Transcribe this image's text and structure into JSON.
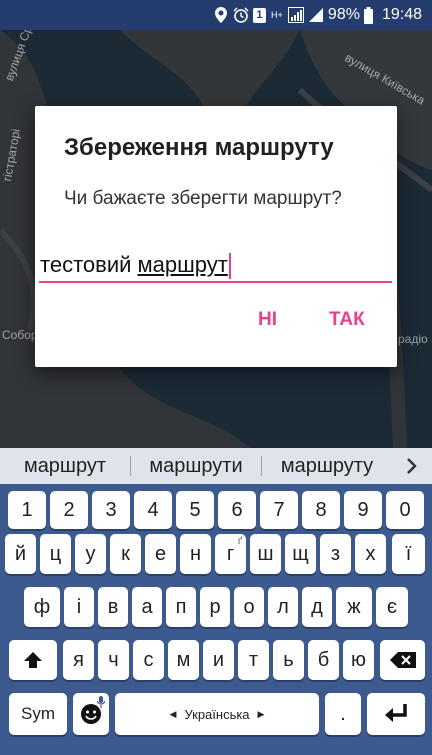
{
  "status_bar": {
    "battery_percent": "98%",
    "time": "19:48",
    "sim_badge": "1",
    "network": "H+",
    "icons": [
      "location-icon",
      "alarm-icon",
      "sim-icon",
      "signal-icon",
      "signal-icon",
      "battery-icon"
    ]
  },
  "map": {
    "labels": [
      "вулиця Срус",
      "вулиця Київська",
      "гістраторі",
      "Собор",
      "радіо"
    ]
  },
  "dialog": {
    "title": "Збереження маршруту",
    "message": "Чи бажаєте зберегти маршрут?",
    "input_plain": "тестовий ",
    "input_underlined": "маршрут",
    "negative_label": "НІ",
    "positive_label": "ТАК"
  },
  "suggestions": {
    "items": [
      "маршрут",
      "маршрути",
      "маршруту"
    ],
    "more_icon": "chevron-right-icon"
  },
  "keyboard": {
    "row1": [
      "1",
      "2",
      "3",
      "4",
      "5",
      "6",
      "7",
      "8",
      "9",
      "0"
    ],
    "row2": [
      "й",
      "ц",
      "у",
      "к",
      "е",
      "н",
      "г",
      "ш",
      "щ",
      "з",
      "х",
      "ї"
    ],
    "row2_alt_g": "ґ",
    "row3": [
      "ф",
      "і",
      "в",
      "а",
      "п",
      "р",
      "о",
      "л",
      "д",
      "ж",
      "є"
    ],
    "row4": [
      "я",
      "ч",
      "с",
      "м",
      "и",
      "т",
      "ь",
      "б",
      "ю"
    ],
    "sym_label": "Sym",
    "comma": ",",
    "period": ".",
    "space_label": "Українська",
    "accent": "#e8438a"
  }
}
